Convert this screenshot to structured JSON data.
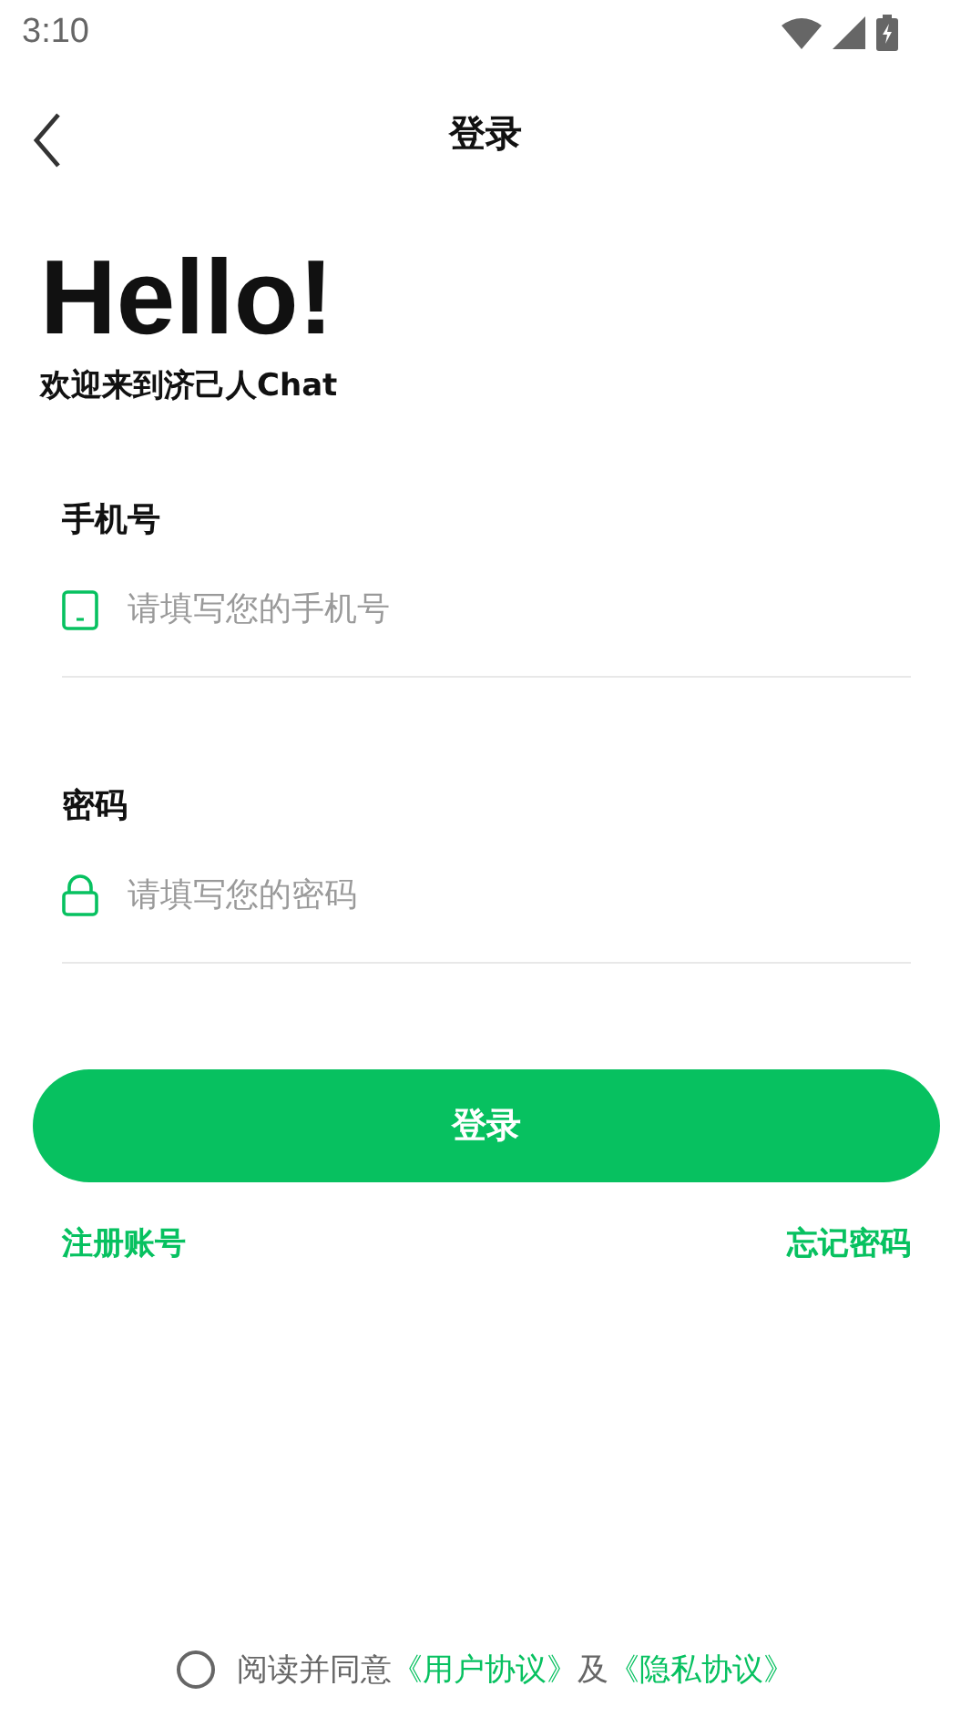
{
  "status_bar": {
    "time": "3:10"
  },
  "nav": {
    "title": "登录"
  },
  "greeting": {
    "title": "Hello!",
    "subtitle": "欢迎来到济己人Chat"
  },
  "fields": [
    {
      "kind": "phone",
      "label": "手机号",
      "placeholder": "请填写您的手机号"
    },
    {
      "kind": "password",
      "label": "密码",
      "placeholder": "请填写您的密码"
    }
  ],
  "login_button": "登录",
  "links": {
    "register": "注册账号",
    "forgot": "忘记密码"
  },
  "agreement": {
    "checked": false,
    "text": "阅读并同意",
    "user_agreement": "《用户协议》",
    "conjunction": "及",
    "privacy_policy": "《隐私协议》"
  }
}
